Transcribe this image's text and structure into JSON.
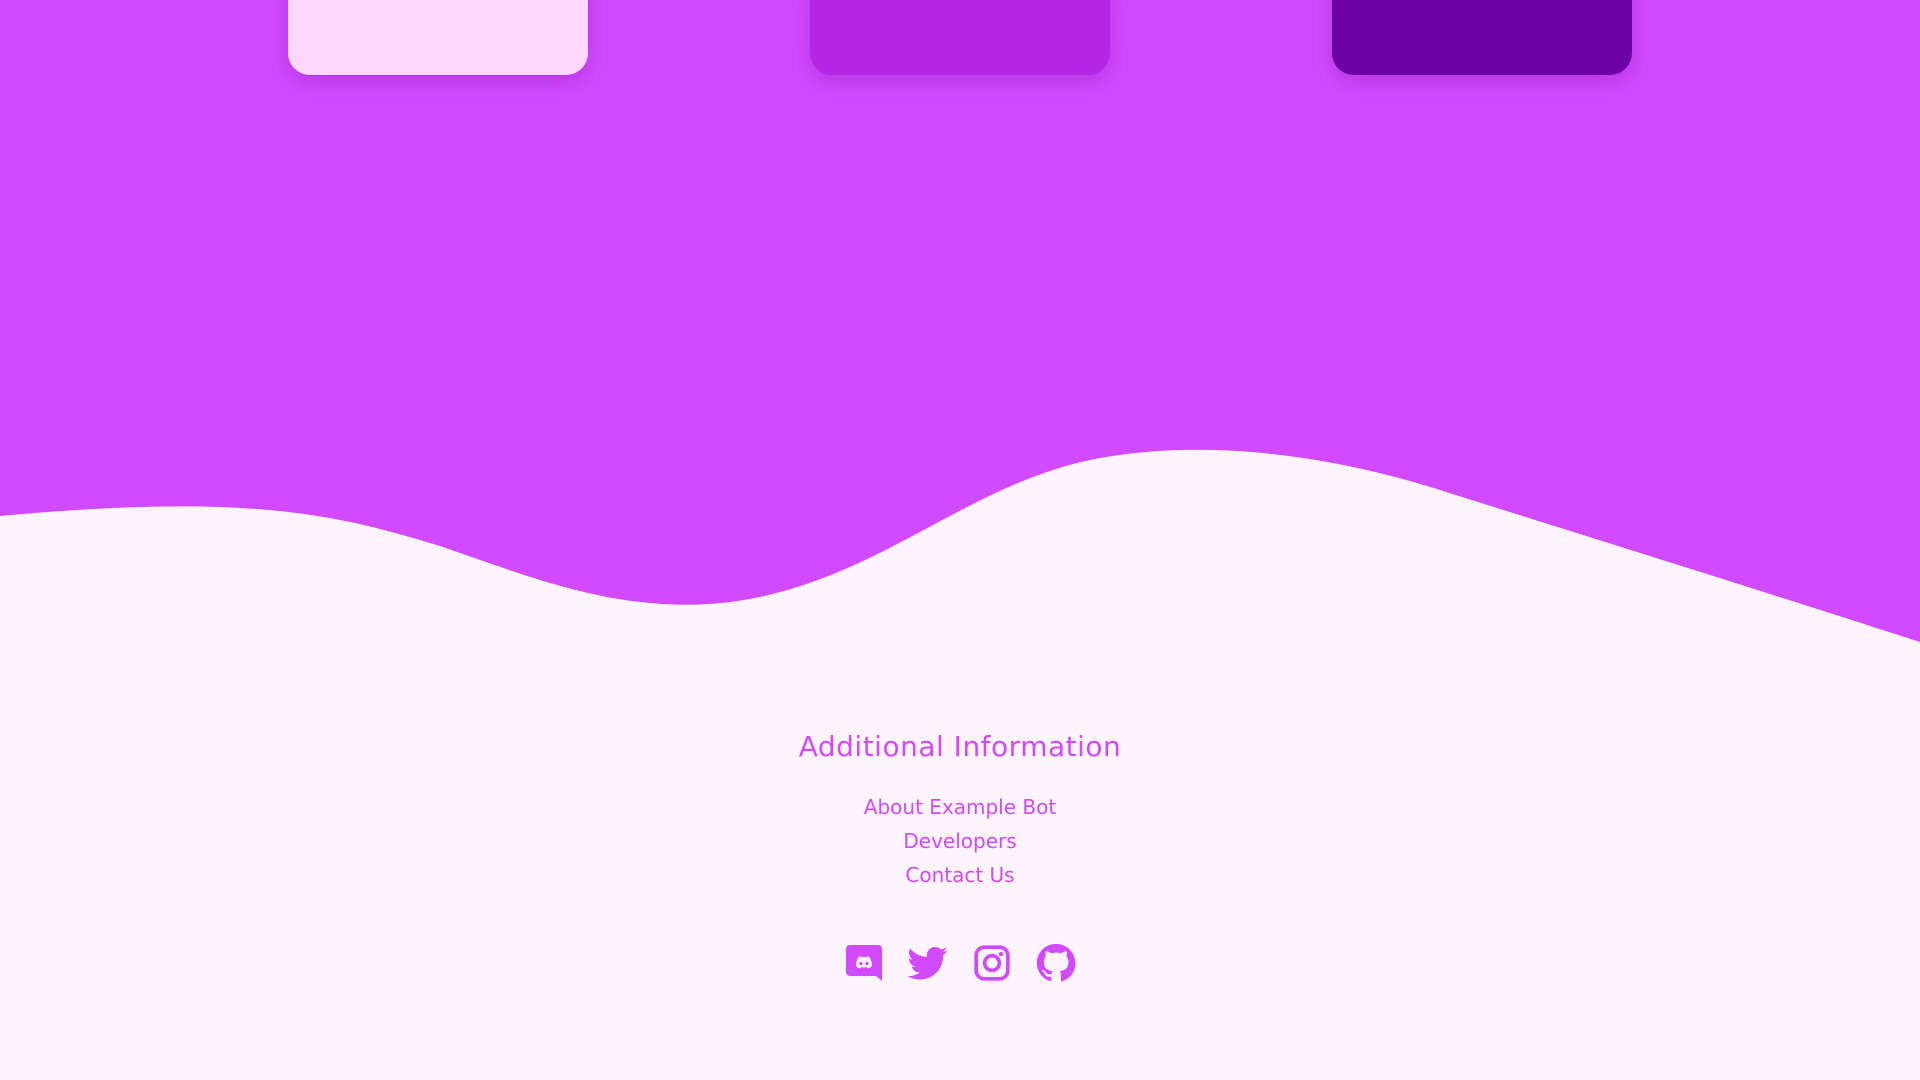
{
  "colors": {
    "accent": "#d24aff",
    "background": "#fdf4fe",
    "card_light": "#ffd7ff",
    "card_mid": "#b426e3",
    "card_dark": "#6e00a8"
  },
  "cards": [
    {
      "name": "card-light"
    },
    {
      "name": "card-mid"
    },
    {
      "name": "card-dark"
    }
  ],
  "footer": {
    "title": "Additional Information",
    "links": [
      {
        "label": "About Example Bot"
      },
      {
        "label": "Developers"
      },
      {
        "label": "Contact Us"
      }
    ],
    "social": [
      {
        "icon": "discord-icon"
      },
      {
        "icon": "twitter-icon"
      },
      {
        "icon": "instagram-icon"
      },
      {
        "icon": "github-icon"
      }
    ]
  }
}
